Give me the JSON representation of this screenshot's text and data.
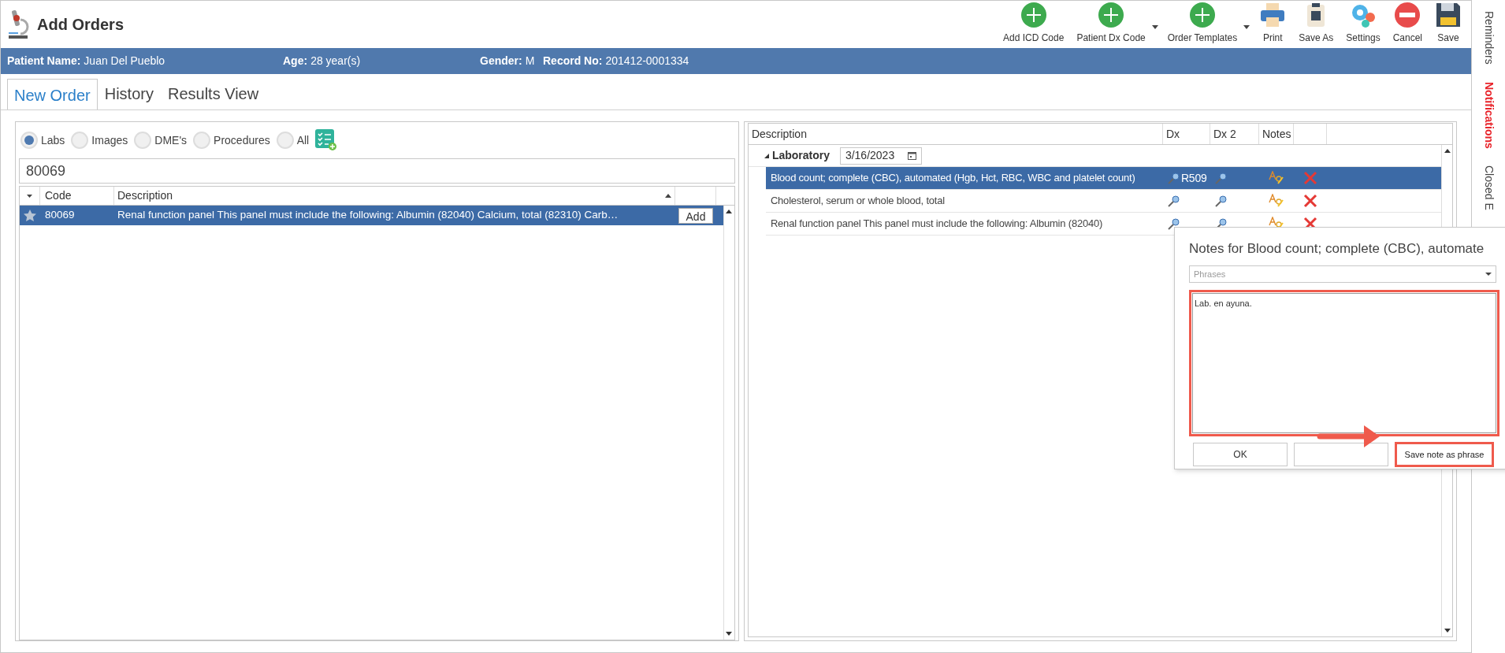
{
  "window": {
    "title": "Add Orders"
  },
  "toolbar": [
    {
      "label": "Add ICD Code",
      "kind": "add",
      "dropdown": false
    },
    {
      "label": "Patient Dx Code",
      "kind": "add",
      "dropdown": true
    },
    {
      "label": "Order Templates",
      "kind": "add",
      "dropdown": true
    },
    {
      "label": "Print",
      "kind": "print",
      "dropdown": false
    },
    {
      "label": "Save As",
      "kind": "saveas",
      "dropdown": false
    },
    {
      "label": "Settings",
      "kind": "settings",
      "dropdown": false
    },
    {
      "label": "Cancel",
      "kind": "cancel",
      "dropdown": false
    },
    {
      "label": "Save",
      "kind": "save",
      "dropdown": false
    }
  ],
  "patient_bar": [
    {
      "label": "Patient Name:",
      "value": "Juan Del Pueblo"
    },
    {
      "label": "Age:",
      "value": "28 year(s)"
    },
    {
      "label": "Gender:",
      "value": "M"
    },
    {
      "label": "Record No:",
      "value": "201412-0001334"
    }
  ],
  "tabs": [
    {
      "label": "New Order",
      "selected": true
    },
    {
      "label": "History",
      "selected": false
    },
    {
      "label": "Results View",
      "selected": false
    }
  ],
  "order_types": [
    {
      "label": "Labs",
      "selected": true
    },
    {
      "label": "Images",
      "selected": false
    },
    {
      "label": "DME's",
      "selected": false
    },
    {
      "label": "Procedures",
      "selected": false
    },
    {
      "label": "All",
      "selected": false
    }
  ],
  "search": {
    "value": "80069"
  },
  "results": {
    "columns": [
      "Code",
      "Description"
    ],
    "rows": [
      {
        "code": "80069",
        "description": "Renal function panel This panel must include the following: Albumin (82040) Calcium, total (82310) Carb…",
        "action": "Add",
        "selected": true
      }
    ]
  },
  "orders": {
    "columns": [
      "Description",
      "Dx",
      "Dx 2",
      "Notes"
    ],
    "group": {
      "label": "Laboratory",
      "date": "3/16/2023",
      "expanded": true
    },
    "rows": [
      {
        "description": "Blood count; complete (CBC), automated (Hgb, Hct, RBC, WBC and platelet count)",
        "dx": "R509",
        "selected": true
      },
      {
        "description": "Cholesterol, serum or whole blood, total",
        "selected": false
      },
      {
        "description": "Renal function panel This panel must include the following: Albumin (82040)",
        "selected": false
      }
    ]
  },
  "notes_popup": {
    "title": "Notes for Blood count; complete (CBC), automate",
    "phrases": {
      "placeholder": "Phrases"
    },
    "note": "Lab. en ayuna.",
    "buttons": [
      "OK",
      "Save note as phrase"
    ]
  },
  "side_tabs": [
    {
      "label": "Reminders",
      "highlighted": false
    },
    {
      "label": "Notifications",
      "highlighted": true
    },
    {
      "label": "Closed E",
      "highlighted": false
    }
  ]
}
